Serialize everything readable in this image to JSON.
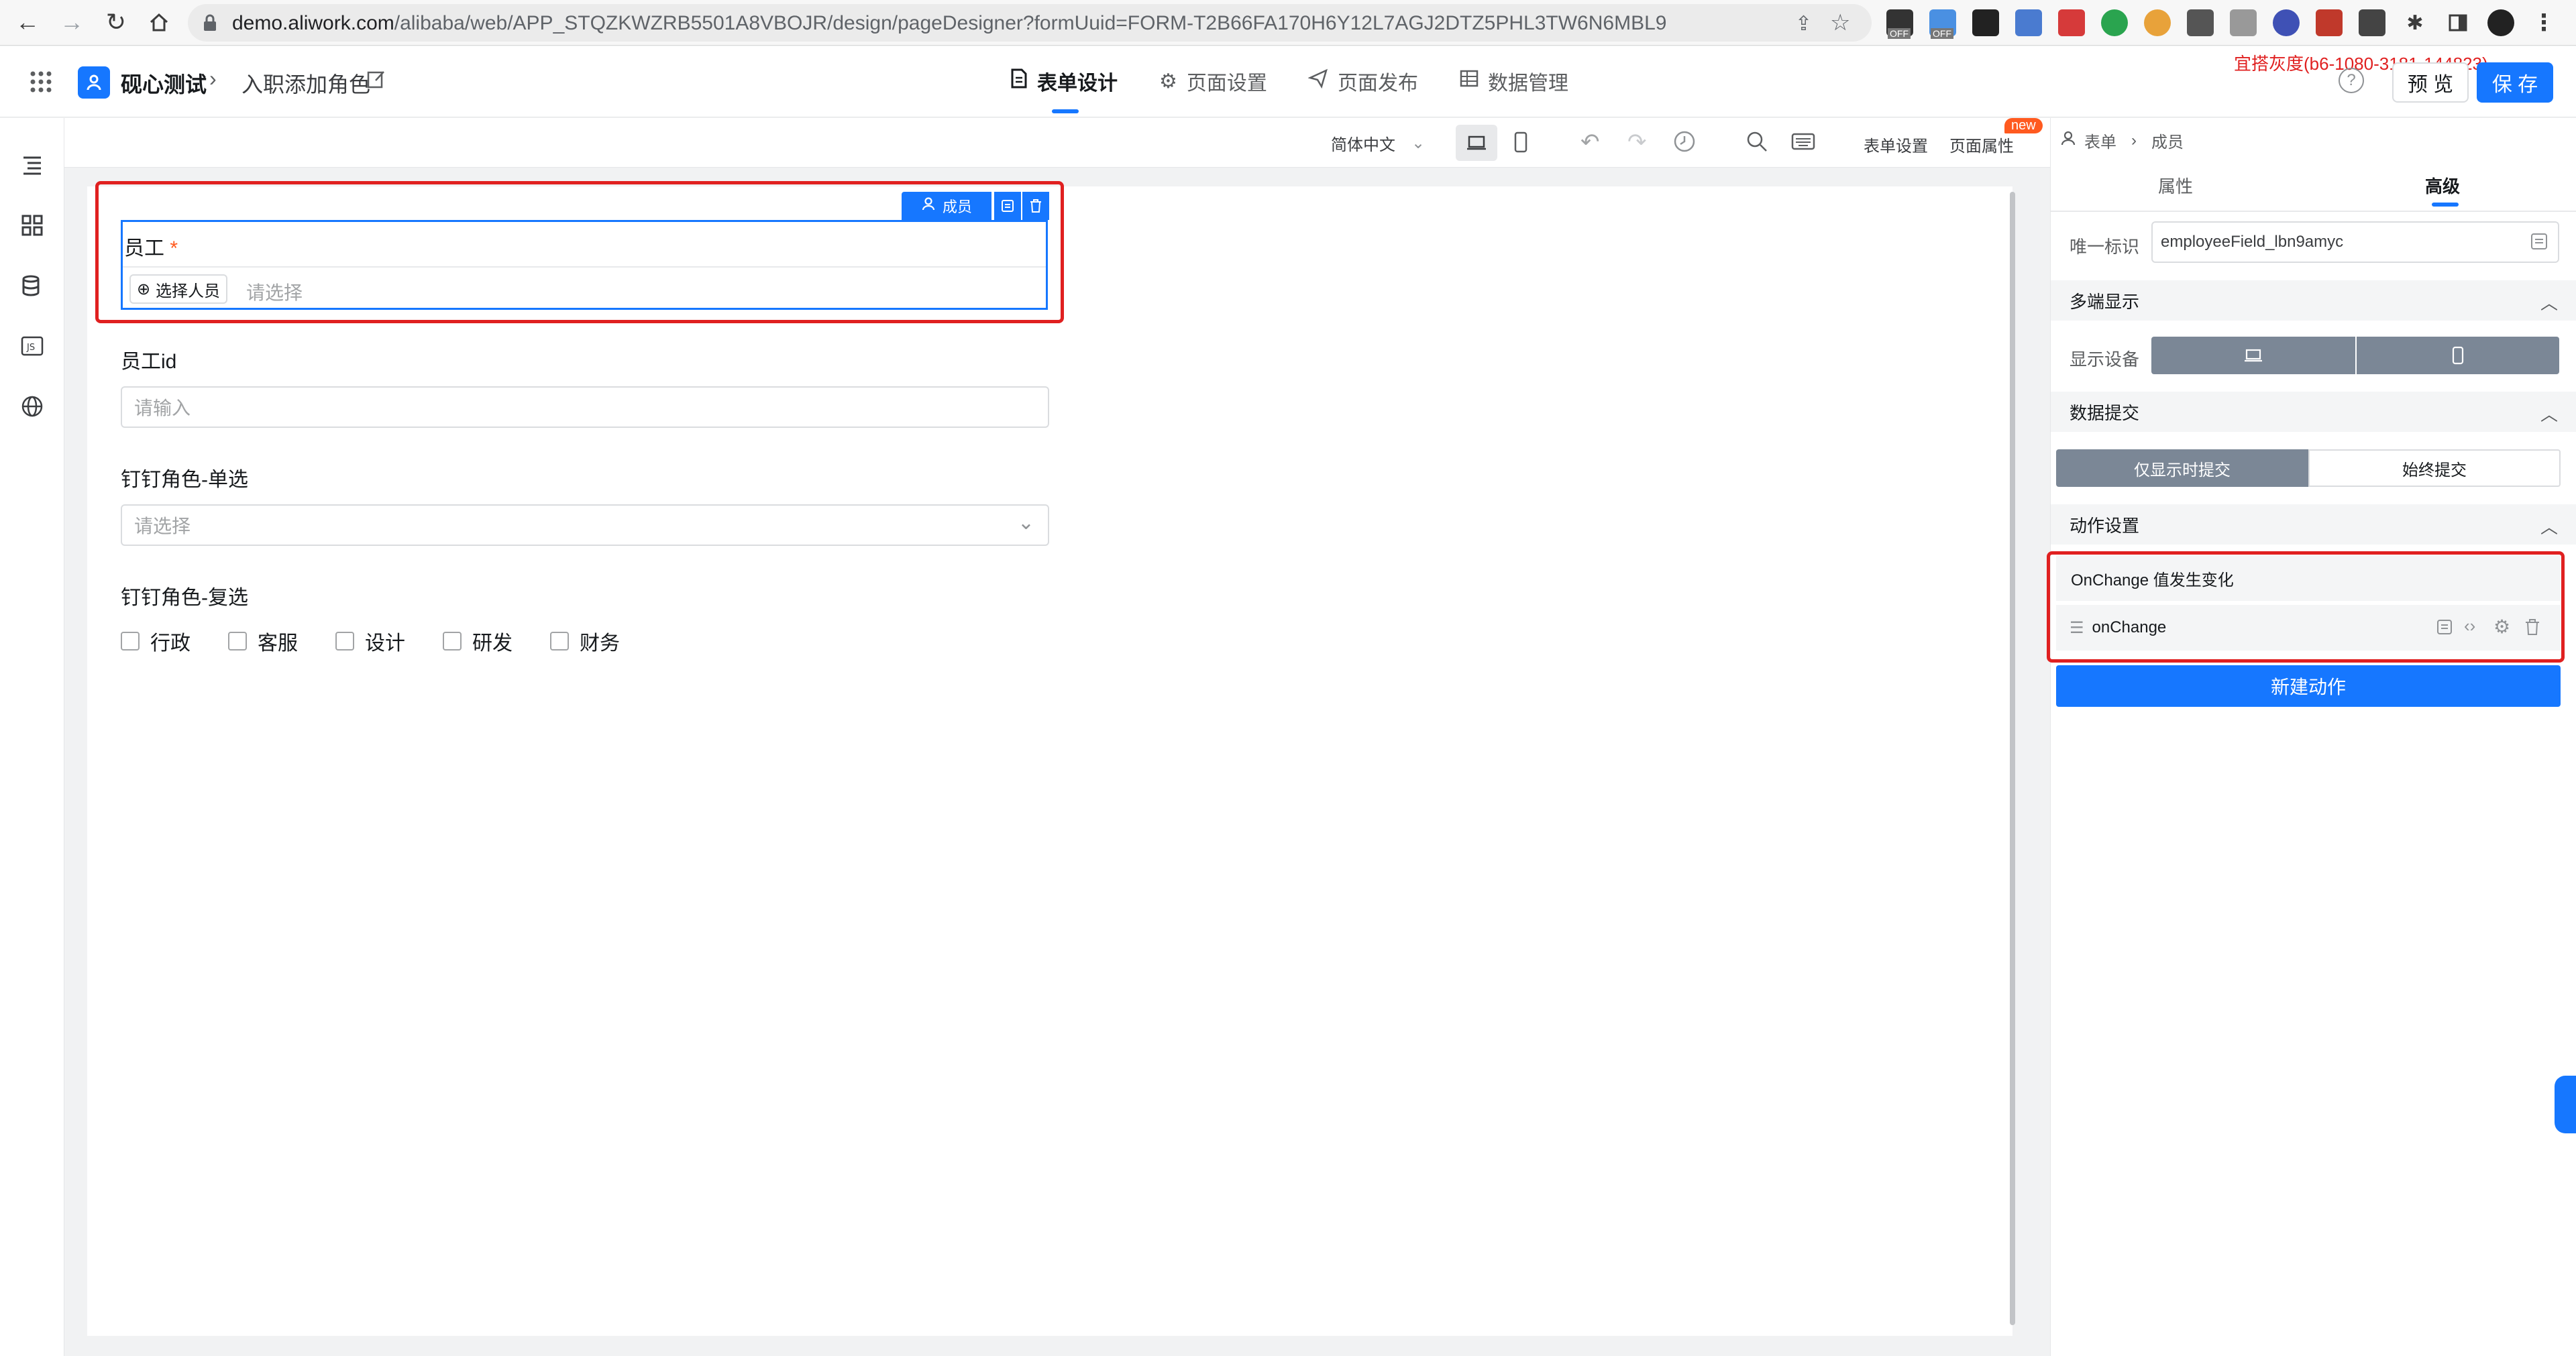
{
  "browser": {
    "url_host": "demo.aliwork.com",
    "url_path": "/alibaba/web/APP_STQZKWZRB5501A8VBOJR/design/pageDesigner?formUuid=FORM-T2B66FA170H6Y12L7AGJ2DTZ5PHL3TW6N6MBL9",
    "ext_off_1": "OFF",
    "ext_off_2": "OFF"
  },
  "header": {
    "app_name": "砚心测试",
    "page_name": "入职添加角色",
    "tabs": [
      {
        "label": "表单设计"
      },
      {
        "label": "页面设置"
      },
      {
        "label": "页面发布"
      },
      {
        "label": "数据管理"
      }
    ],
    "env_label": "宜搭灰度(b6-1080-3181-144823)",
    "preview_label": "预 览",
    "save_label": "保 存"
  },
  "toolbar": {
    "language": "简体中文",
    "form_settings": "表单设置",
    "page_props": "页面属性",
    "new_badge": "new"
  },
  "form": {
    "selected_field_tag": "成员",
    "fields": [
      {
        "label": "员工",
        "required_mark": "*",
        "button": "选择人员",
        "placeholder": "请选择"
      },
      {
        "label": "员工id",
        "placeholder": "请输入"
      },
      {
        "label": "钉钉角色-单选",
        "placeholder": "请选择"
      },
      {
        "label": "钉钉角色-复选",
        "options": [
          "行政",
          "客服",
          "设计",
          "研发",
          "财务"
        ]
      }
    ]
  },
  "panel": {
    "breadcrumb_1": "表单",
    "breadcrumb_2": "成员",
    "tab_props": "属性",
    "tab_advanced": "高级",
    "unique_id_label": "唯一标识",
    "unique_id_value": "employeeField_lbn9amyc",
    "section_multi": "多端显示",
    "display_device_label": "显示设备",
    "section_submit": "数据提交",
    "submit_option_1": "仅显示时提交",
    "submit_option_2": "始终提交",
    "section_actions": "动作设置",
    "action_event": "OnChange 值发生变化",
    "action_name": "onChange",
    "new_action": "新建动作"
  },
  "colors": {
    "primary": "#1677ff",
    "highlight": "#e02020",
    "selected_segment": "#7b8796"
  }
}
